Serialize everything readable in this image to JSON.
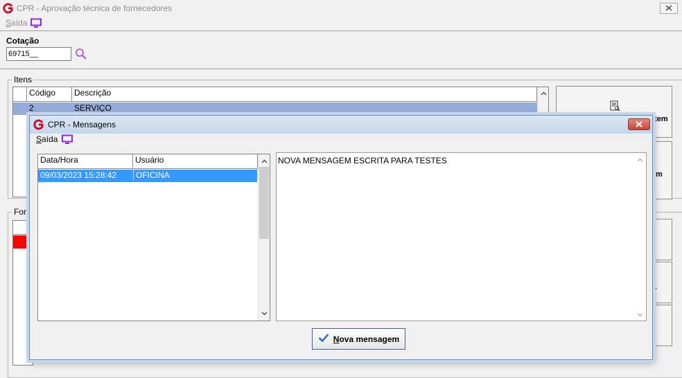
{
  "main_window": {
    "title": "CPR - Aprovação técnica de fornecedores",
    "menu": {
      "exit_label_first": "S",
      "exit_label_rest": "aída"
    },
    "quote": {
      "label": "Cotação",
      "value": "69715__"
    },
    "items_group": {
      "caption": "Itens",
      "columns": [
        "Código",
        "Descrição"
      ],
      "rows": [
        {
          "code": "2",
          "description": "SERVIÇO"
        }
      ]
    },
    "side_buttons": [
      {
        "label": "Item"
      },
      {
        "label": "m"
      }
    ],
    "suppliers_group": {
      "caption": "Forn"
    },
    "right_partial": {
      "letter_r": "r"
    }
  },
  "dialog": {
    "title": "CPR - Mensagens",
    "menu": {
      "exit_label_first": "S",
      "exit_label_rest": "aída"
    },
    "grid": {
      "columns": [
        "Data/Hora",
        "Usuário"
      ],
      "rows": [
        {
          "datetime": "09/03/2023 15:28:42",
          "user": "OFICINA"
        }
      ]
    },
    "message_text": "NOVA MENSAGEM ESCRITA PARA TESTES",
    "new_message_button": {
      "label_first": "N",
      "label_rest": "ova mensagem"
    }
  },
  "colors": {
    "logo_red": "#c8102e",
    "selected_item_row": "#95acd9",
    "selected_message_row": "#3399ff",
    "supplier_row_red": "#ff0000",
    "monitor_icon": "#8a2be2"
  },
  "icons": [
    "app-logo-icon",
    "monitor-icon",
    "search-icon",
    "close-icon",
    "report-icon",
    "checkmark-icon",
    "chevron-up-icon",
    "chevron-down-icon"
  ]
}
